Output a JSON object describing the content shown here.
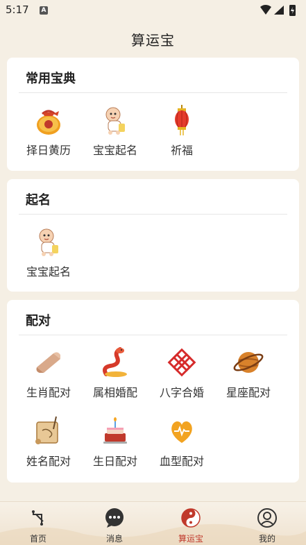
{
  "status": {
    "time": "5:17",
    "notification_icon": "a-icon"
  },
  "app": {
    "title": "算运宝"
  },
  "sections": [
    {
      "title": "常用宝典",
      "items": [
        {
          "label": "择日黄历",
          "icon": "lucky-bag-icon"
        },
        {
          "label": "宝宝起名",
          "icon": "baby-icon"
        },
        {
          "label": "祈福",
          "icon": "lantern-icon"
        }
      ]
    },
    {
      "title": "起名",
      "items": [
        {
          "label": "宝宝起名",
          "icon": "baby-icon"
        }
      ]
    },
    {
      "title": "配对",
      "items": [
        {
          "label": "生肖配对",
          "icon": "scroll-icon"
        },
        {
          "label": "属相婚配",
          "icon": "snake-icon"
        },
        {
          "label": "八字合婚",
          "icon": "chinese-knot-icon"
        },
        {
          "label": "星座配对",
          "icon": "planet-icon"
        },
        {
          "label": "姓名配对",
          "icon": "parchment-icon"
        },
        {
          "label": "生日配对",
          "icon": "birthday-cake-icon"
        },
        {
          "label": "血型配对",
          "icon": "heart-icon"
        }
      ]
    }
  ],
  "nav": {
    "items": [
      {
        "label": "首页",
        "icon": "home-icon",
        "active": false
      },
      {
        "label": "消息",
        "icon": "message-icon",
        "active": false
      },
      {
        "label": "算运宝",
        "icon": "yin-yang-icon",
        "active": true
      },
      {
        "label": "我的",
        "icon": "profile-icon",
        "active": false
      }
    ]
  },
  "colors": {
    "accent": "#c0392b",
    "background": "#f5efe4",
    "card": "#ffffff"
  }
}
